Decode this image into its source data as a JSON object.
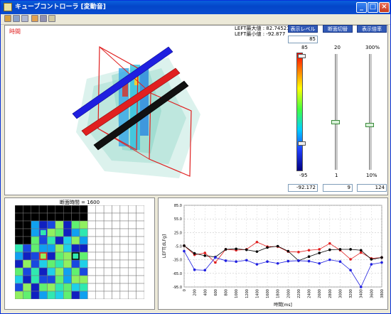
{
  "window": {
    "title": "キューブコントローラ [変動音]"
  },
  "cube_view": {
    "label_time": "時間",
    "max_label": "LEFT最大値 : 82.74521",
    "min_label": "LEFT最小値 : -92.877"
  },
  "buttons": {
    "display_level": "表示レベル",
    "section_switch": "断面切替",
    "display_scale": "表示倍率"
  },
  "level_input": "85",
  "color_scale": {
    "max": "85",
    "min": "-95"
  },
  "slider_mid": {
    "max": "20",
    "min": "1"
  },
  "slider_right": {
    "max": "300%",
    "min": "10%"
  },
  "bottom_values": {
    "left": "-92.172",
    "mid": "9",
    "right": "124"
  },
  "grid_panel": {
    "title": "断面時間 = 1600"
  },
  "colors": {
    "red": "#e02020",
    "black": "#000000",
    "blue": "#1f1fe0"
  },
  "chart_data": {
    "type": "line",
    "xlabel": "時間[ms]",
    "ylabel": "LEFT[dLFg]",
    "ylim": [
      -95,
      85
    ],
    "yticks": [
      "85.0",
      "55.0",
      "25.0",
      "-5.0",
      "-35.0",
      "-65.0",
      "-95.0"
    ],
    "x": [
      0,
      200,
      400,
      600,
      800,
      1000,
      1200,
      1400,
      1600,
      1800,
      2000,
      2200,
      2400,
      2600,
      2800,
      3000,
      3200,
      3400,
      3600,
      3800
    ],
    "xticks": [
      "0",
      "200",
      "400",
      "600",
      "800",
      "1000",
      "1200",
      "1400",
      "1600",
      "1800",
      "2000",
      "2200",
      "2400",
      "2600",
      "2800",
      "3000",
      "3200",
      "3400",
      "3600",
      "3800"
    ],
    "series": [
      {
        "color": "#e02020",
        "values": [
          -4,
          -24,
          -20,
          -41,
          -12,
          -14,
          -12,
          4,
          -6,
          -6,
          -17,
          -18,
          -14,
          -12,
          1,
          -14,
          -34,
          -19,
          -32,
          -30
        ]
      },
      {
        "color": "#000000",
        "values": [
          -4,
          -21,
          -26,
          -29,
          -12,
          -11,
          -13,
          -17,
          -8,
          -5,
          -16,
          -37,
          -28,
          -20,
          -13,
          -12,
          -12,
          -14,
          -34,
          -30
        ]
      },
      {
        "color": "#1f1fe0",
        "values": [
          -16,
          -57,
          -58,
          -30,
          -37,
          -39,
          -36,
          -45,
          -39,
          -43,
          -38,
          -37,
          -38,
          -43,
          -35,
          -39,
          -58,
          -95,
          -45,
          -41
        ]
      }
    ]
  }
}
